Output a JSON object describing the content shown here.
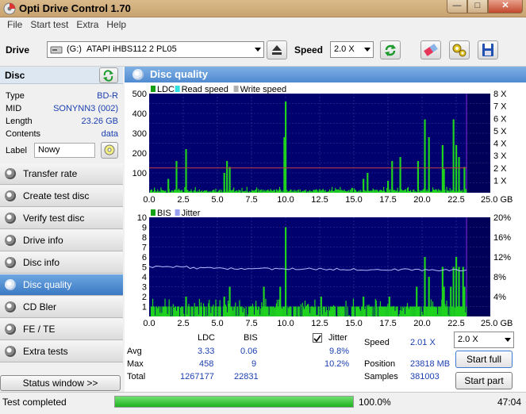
{
  "window": {
    "title": "Opti Drive Control 1.70"
  },
  "menu": [
    "File",
    "Start test",
    "Extra",
    "Help"
  ],
  "toolbar": {
    "drive_label": "Drive",
    "drive_letter": "(G:)",
    "drive_name": "ATAPI iHBS112   2 PL05",
    "speed_label": "Speed",
    "speed_value": "2.0 X"
  },
  "disc": {
    "header": "Disc",
    "rows": [
      {
        "key": "Type",
        "value": "BD-R"
      },
      {
        "key": "MID",
        "value": "SONYNN3 (002)"
      },
      {
        "key": "Length",
        "value": "23.26 GB"
      },
      {
        "key": "Contents",
        "value": "data"
      }
    ],
    "label_key": "Label",
    "label_value": "Nowy"
  },
  "nav": [
    {
      "label": "Transfer rate",
      "active": false
    },
    {
      "label": "Create test disc",
      "active": false
    },
    {
      "label": "Verify test disc",
      "active": false
    },
    {
      "label": "Drive info",
      "active": false
    },
    {
      "label": "Disc info",
      "active": false
    },
    {
      "label": "Disc quality",
      "active": true
    },
    {
      "label": "CD Bler",
      "active": false
    },
    {
      "label": "FE / TE",
      "active": false
    },
    {
      "label": "Extra tests",
      "active": false
    }
  ],
  "status_window": "Status window >>",
  "panel_title": "Disc quality",
  "chart_data": [
    {
      "type": "bar",
      "legend": [
        "LDC",
        "Read speed",
        "Write speed"
      ],
      "legend_colors": [
        "#14a014",
        "#33e0e0",
        "#b0b0b0"
      ],
      "x_ticks": [
        "0.0",
        "2.5",
        "5.0",
        "7.5",
        "10.0",
        "12.5",
        "15.0",
        "17.5",
        "20.0",
        "22.5",
        "25.0 GB"
      ],
      "xlim": [
        0,
        25
      ],
      "ylim": [
        0,
        500
      ],
      "y_ticks_left": [
        "100",
        "200",
        "300",
        "400",
        "500"
      ],
      "y_ticks_right": [
        "1 X",
        "2 X",
        "3 X",
        "4 X",
        "5 X",
        "6 X",
        "7 X",
        "8 X"
      ],
      "data_end": 23.26,
      "spikes": [
        [
          1.4,
          70
        ],
        [
          2.0,
          160
        ],
        [
          2.7,
          220
        ],
        [
          5.5,
          100
        ],
        [
          5.7,
          160
        ],
        [
          5.9,
          130
        ],
        [
          9.9,
          280
        ],
        [
          10.0,
          460
        ],
        [
          15.7,
          70
        ],
        [
          16.0,
          100
        ],
        [
          17.5,
          60
        ],
        [
          17.8,
          160
        ],
        [
          18.4,
          180
        ],
        [
          19.7,
          160
        ],
        [
          20.2,
          370
        ],
        [
          20.5,
          280
        ],
        [
          21.5,
          240
        ],
        [
          21.6,
          120
        ],
        [
          22.3,
          370
        ],
        [
          22.5,
          240
        ],
        [
          22.7,
          180
        ],
        [
          23.1,
          130
        ]
      ],
      "speed_level_x": 2.0
    },
    {
      "type": "bar",
      "legend": [
        "BIS",
        "Jitter"
      ],
      "legend_colors": [
        "#14a014",
        "#9aa0f0"
      ],
      "x_ticks": [
        "0.0",
        "2.5",
        "5.0",
        "7.5",
        "10.0",
        "12.5",
        "15.0",
        "17.5",
        "20.0",
        "22.5",
        "25.0 GB"
      ],
      "xlim": [
        0,
        25
      ],
      "ylim": [
        0,
        10
      ],
      "y_ticks_left": [
        "1",
        "2",
        "3",
        "4",
        "5",
        "6",
        "7",
        "8",
        "9",
        "10"
      ],
      "y_ticks_right": [
        "4%",
        "8%",
        "12%",
        "16%",
        "20%"
      ],
      "data_end": 23.26,
      "jitter_pct": 9.8,
      "spikes": [
        [
          2.7,
          2
        ],
        [
          5.5,
          2
        ],
        [
          5.9,
          3
        ],
        [
          8.4,
          3
        ],
        [
          9.6,
          3
        ],
        [
          10.0,
          9
        ],
        [
          12.6,
          2
        ],
        [
          15.7,
          2
        ],
        [
          17.6,
          2
        ],
        [
          19.6,
          3
        ],
        [
          20.2,
          6
        ],
        [
          20.5,
          4
        ],
        [
          21.5,
          5
        ],
        [
          21.6,
          3
        ],
        [
          22.1,
          3
        ],
        [
          22.3,
          5
        ],
        [
          22.5,
          6
        ],
        [
          22.7,
          5
        ],
        [
          23.0,
          5
        ],
        [
          23.1,
          3
        ]
      ]
    }
  ],
  "stats": {
    "col_ldc": "LDC",
    "col_bis": "BIS",
    "jitter_label": "Jitter",
    "rows": [
      {
        "label": "Avg",
        "ldc": "3.33",
        "bis": "0.06",
        "jitter": "9.8%"
      },
      {
        "label": "Max",
        "ldc": "458",
        "bis": "9",
        "jitter": "10.2%"
      },
      {
        "label": "Total",
        "ldc": "1267177",
        "bis": "22831",
        "jitter": ""
      }
    ],
    "speed_label": "Speed",
    "speed_value": "2.01 X",
    "speed_select": "2.0 X",
    "position_label": "Position",
    "position_value": "23818 MB",
    "samples_label": "Samples",
    "samples_value": "381003",
    "start_full": "Start full",
    "start_part": "Start part"
  },
  "statusbar": {
    "text": "Test completed",
    "progress": 100.0,
    "progress_text": "100.0%",
    "time": "47:04"
  }
}
